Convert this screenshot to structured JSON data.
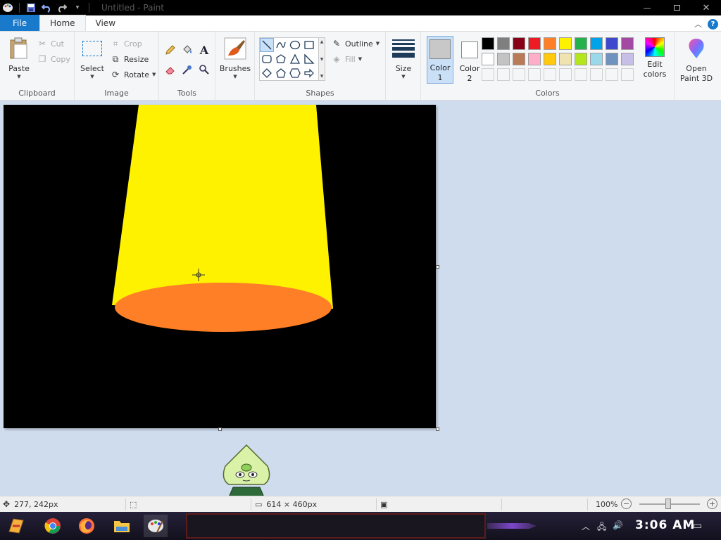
{
  "window": {
    "title": "Untitled - Paint",
    "minimize_icon": "minimize-icon",
    "maximize_icon": "maximize-icon",
    "close_icon": "close-icon"
  },
  "tabs": [
    {
      "label": "File"
    },
    {
      "label": "Home"
    },
    {
      "label": "View"
    }
  ],
  "ribbon": {
    "clipboard": {
      "group_label": "Clipboard",
      "paste": "Paste",
      "cut": "Cut",
      "copy": "Copy"
    },
    "image": {
      "group_label": "Image",
      "select": "Select",
      "crop": "Crop",
      "resize": "Resize",
      "rotate": "Rotate"
    },
    "tools": {
      "group_label": "Tools"
    },
    "brushes": {
      "label": "Brushes"
    },
    "shapes": {
      "group_label": "Shapes",
      "outline": "Outline",
      "fill": "Fill"
    },
    "size": {
      "label": "Size"
    },
    "colors": {
      "group_label": "Colors",
      "color1_label": "Color\n1",
      "color1_value": "#c8c8c8",
      "color2_label": "Color\n2",
      "color2_value": "#ffffff",
      "edit_colors": "Edit colors",
      "palette": [
        "#000000",
        "#7f7f7f",
        "#880015",
        "#ed1c24",
        "#ff7f27",
        "#fff200",
        "#22b14c",
        "#00a2e8",
        "#3f48cc",
        "#a349a4",
        "#ffffff",
        "#c3c3c3",
        "#b97a57",
        "#ffaec9",
        "#ffc90e",
        "#efe4b0",
        "#b5e61d",
        "#99d9ea",
        "#7092be",
        "#c8bfe7",
        "#f5f6f7",
        "#f5f6f7",
        "#f5f6f7",
        "#f5f6f7",
        "#f5f6f7",
        "#f5f6f7",
        "#f5f6f7",
        "#f5f6f7",
        "#f5f6f7",
        "#f5f6f7"
      ]
    },
    "paint3d": {
      "label": "Open Paint 3D"
    }
  },
  "canvas": {
    "background": "#000000",
    "beam_color": "#fff200",
    "ellipse_color": "#ff7f27"
  },
  "statusbar": {
    "cursor_position": "277, 242px",
    "image_size": "614 × 460px",
    "zoom": "100%"
  },
  "taskbar": {
    "clock": "3:06 AM"
  }
}
